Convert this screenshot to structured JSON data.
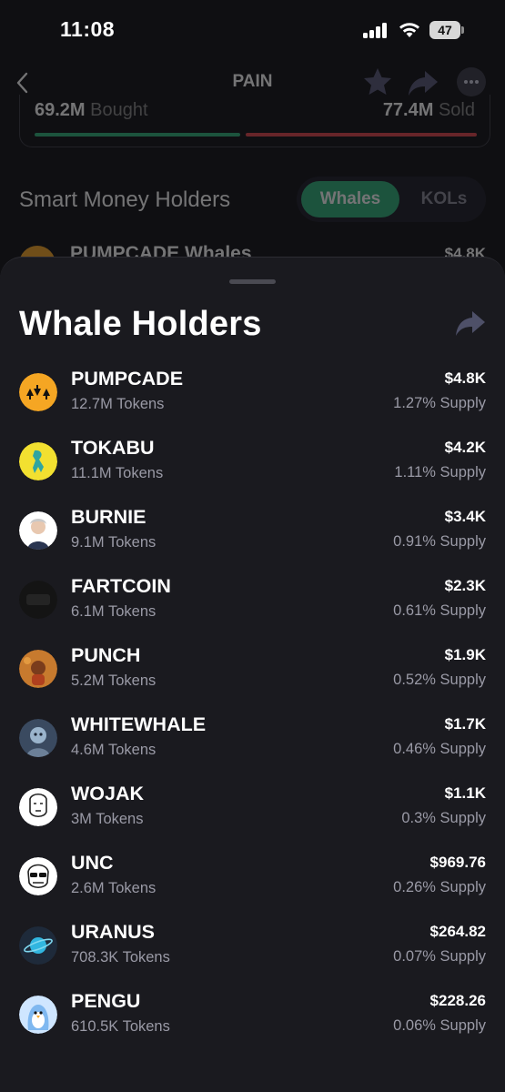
{
  "status_bar": {
    "time": "11:08",
    "battery": "47",
    "icons": [
      "signal-icon",
      "wifi-icon",
      "battery-icon"
    ]
  },
  "nav": {
    "title": "PAIN",
    "icons": [
      "back-icon",
      "star-icon",
      "share-icon",
      "more-icon"
    ]
  },
  "volume": {
    "bought_value": "69.2M",
    "bought_label": "Bought",
    "sold_value": "77.4M",
    "sold_label": "Sold",
    "bought_color": "#2fb37a",
    "sold_color": "#e0444a"
  },
  "smart_money": {
    "title": "Smart Money Holders",
    "tabs": [
      {
        "label": "Whales",
        "selected": true
      },
      {
        "label": "KOLs",
        "selected": false
      }
    ],
    "first_row": {
      "name": "PUMPCADE Whales",
      "value": "$4.8K"
    }
  },
  "sheet": {
    "title": "Whale Holders",
    "share_icon": "share-icon",
    "holders": [
      {
        "name": "PUMPCADE",
        "tokens": "12.7M Tokens",
        "value": "$4.8K",
        "supply": "1.27% Supply",
        "color": "#f5a623"
      },
      {
        "name": "TOKABU",
        "tokens": "11.1M Tokens",
        "value": "$4.2K",
        "supply": "1.11% Supply",
        "color": "#f2e030"
      },
      {
        "name": "BURNIE",
        "tokens": "9.1M Tokens",
        "value": "$3.4K",
        "supply": "0.91% Supply",
        "color": "#ffffff"
      },
      {
        "name": "FARTCOIN",
        "tokens": "6.1M Tokens",
        "value": "$2.3K",
        "supply": "0.61% Supply",
        "color": "#141414"
      },
      {
        "name": "PUNCH",
        "tokens": "5.2M Tokens",
        "value": "$1.9K",
        "supply": "0.52% Supply",
        "color": "#c77a2e"
      },
      {
        "name": "WHITEWHALE",
        "tokens": "4.6M Tokens",
        "value": "$1.7K",
        "supply": "0.46% Supply",
        "color": "#3a4a60"
      },
      {
        "name": "WOJAK",
        "tokens": "3M Tokens",
        "value": "$1.1K",
        "supply": "0.3% Supply",
        "color": "#ffffff"
      },
      {
        "name": "UNC",
        "tokens": "2.6M Tokens",
        "value": "$969.76",
        "supply": "0.26% Supply",
        "color": "#ffffff"
      },
      {
        "name": "URANUS",
        "tokens": "708.3K Tokens",
        "value": "$264.82",
        "supply": "0.07% Supply",
        "color": "#1e2a3a"
      },
      {
        "name": "PENGU",
        "tokens": "610.5K Tokens",
        "value": "$228.26",
        "supply": "0.06% Supply",
        "color": "#cfe6ff"
      }
    ]
  }
}
